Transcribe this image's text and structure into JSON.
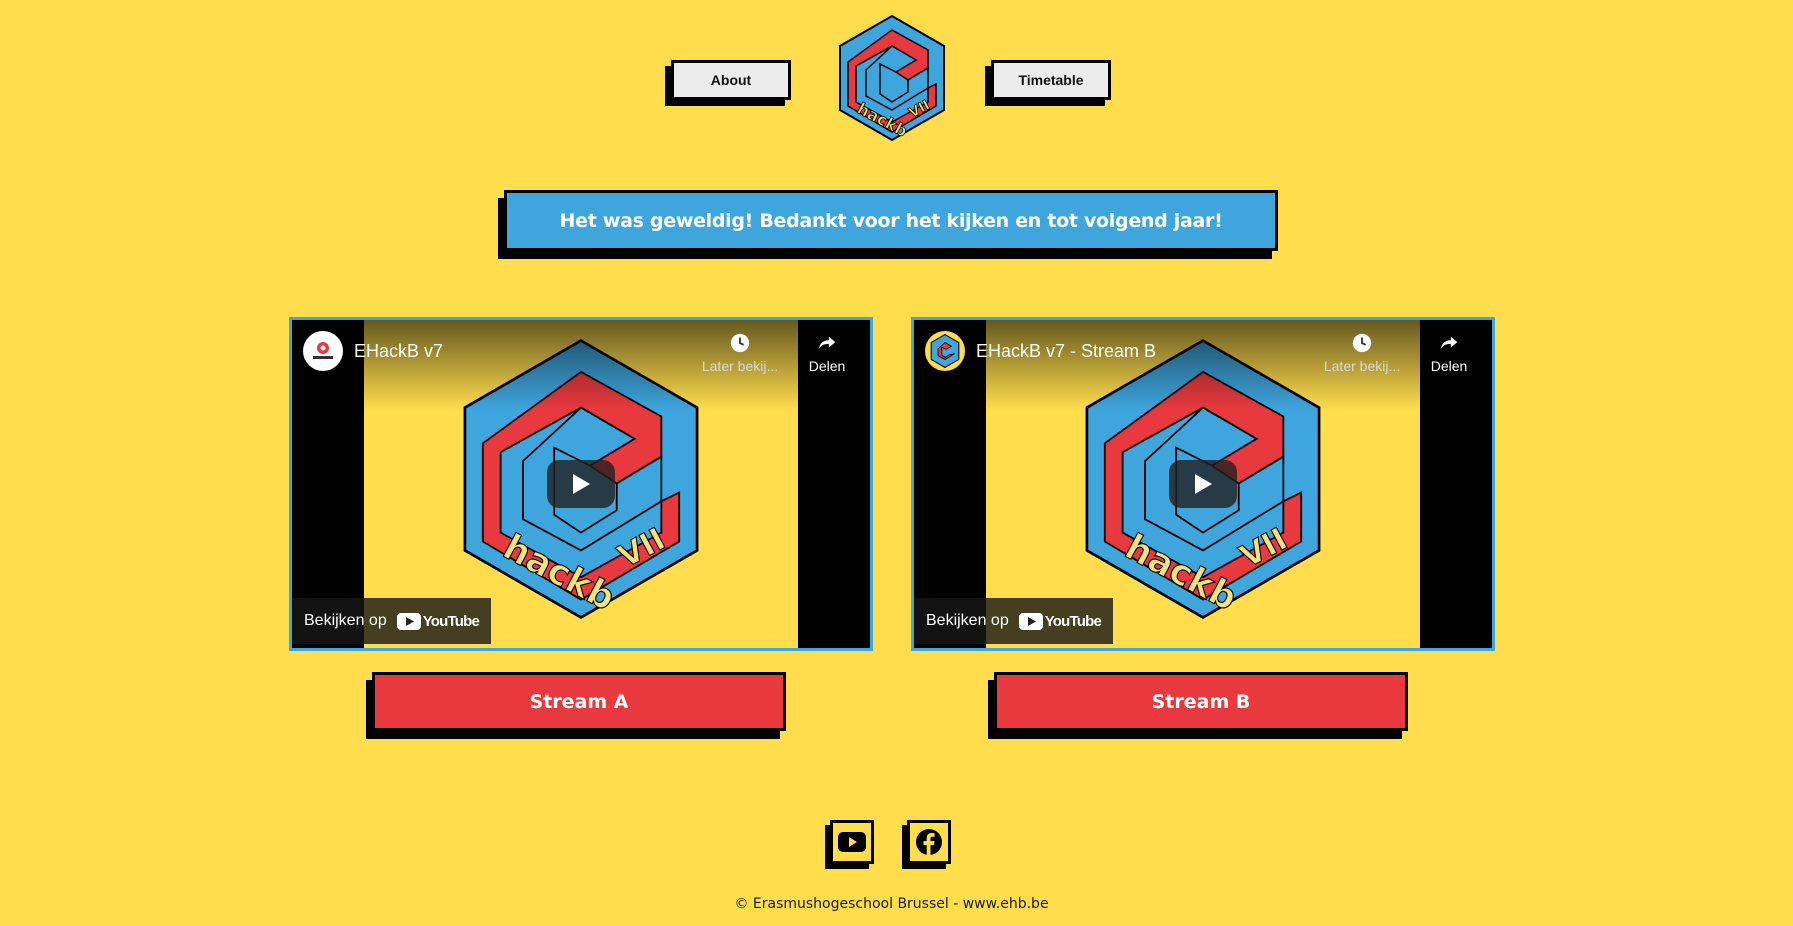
{
  "nav": {
    "about_label": "About",
    "timetable_label": "Timetable"
  },
  "logo": {
    "text_main": "hackb",
    "text_version": "VII"
  },
  "banner": {
    "message": "Het was geweldig! Bedankt voor het kijken en tot volgend jaar!"
  },
  "videos": [
    {
      "title": "EHackB v7",
      "channel_avatar": "erasmus",
      "watch_later_label": "Later bekij...",
      "share_label": "Delen",
      "watch_on_label": "Bekijken op",
      "youtube_label": "YouTube",
      "thumb_text_main": "hackb",
      "thumb_text_version": "VII",
      "button_label": "Stream A"
    },
    {
      "title": "EHackB v7 - Stream B",
      "channel_avatar": "ehackb-logo",
      "watch_later_label": "Later bekij...",
      "share_label": "Delen",
      "watch_on_label": "Bekijken op",
      "youtube_label": "YouTube",
      "thumb_text_main": "hackb",
      "thumb_text_version": "VII",
      "button_label": "Stream B"
    }
  ],
  "social": {
    "youtube_icon": "youtube-icon",
    "facebook_icon": "facebook-icon"
  },
  "footer": {
    "text": "© Erasmushogeschool Brussel - www.ehb.be"
  },
  "colors": {
    "background": "#ffdd4d",
    "blue": "#3ea5dd",
    "red": "#e83a3e",
    "black": "#000000"
  }
}
